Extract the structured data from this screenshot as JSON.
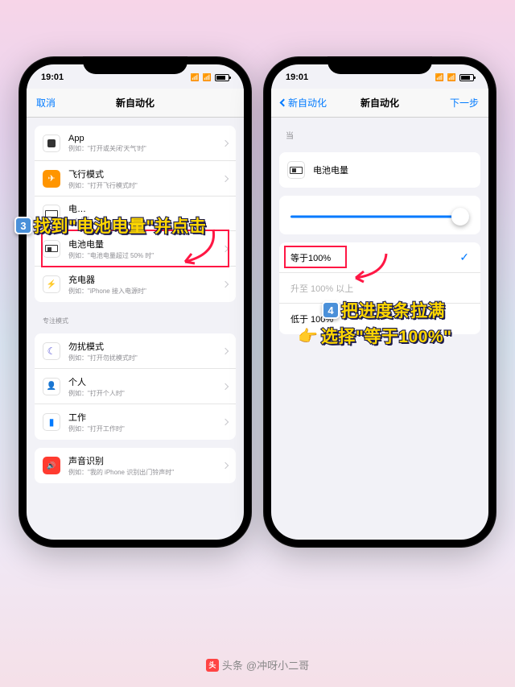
{
  "statusbar": {
    "time": "19:01"
  },
  "left_phone": {
    "nav": {
      "cancel": "取消",
      "title": "新自动化"
    },
    "rows": {
      "app": {
        "title": "App",
        "sub": "例如：\"打开或关闭'天气'时\""
      },
      "airplane": {
        "title": "飞行模式",
        "sub": "例如：\"打开飞行模式时\""
      },
      "batt_e": {
        "title": "电…",
        "sub": "…：\"低…"
      },
      "batt_l": {
        "title": "电池电量",
        "sub": "例如：\"电池电量超过 50% 时\""
      },
      "charger": {
        "title": "充电器",
        "sub": "例如：\"iPhone 接入电源时\""
      },
      "dnd": {
        "title": "勿扰模式",
        "sub": "例如：\"打开勿扰模式时\""
      },
      "personal": {
        "title": "个人",
        "sub": "例如：\"打开个人时\""
      },
      "work": {
        "title": "工作",
        "sub": "例如：\"打开工作时\""
      },
      "sound": {
        "title": "声音识别",
        "sub": "例如：\"我的 iPhone 识别出门铃声时\""
      }
    },
    "focus_header": "专注模式"
  },
  "right_phone": {
    "nav": {
      "back": "新自动化",
      "title": "新自动化",
      "next": "下一步"
    },
    "when": "当",
    "battery_row": "电池电量",
    "options": {
      "equals": "等于100%",
      "rises": "升至 100% 以上",
      "falls": "低于 100%"
    }
  },
  "annotations": {
    "step3": "找到\"电池电量\"并点击",
    "step4a": "把进度条拉满",
    "step4b": "选择\"等于100%\""
  },
  "footer": {
    "prefix": "头条",
    "author": "@冲呀小二哥"
  }
}
